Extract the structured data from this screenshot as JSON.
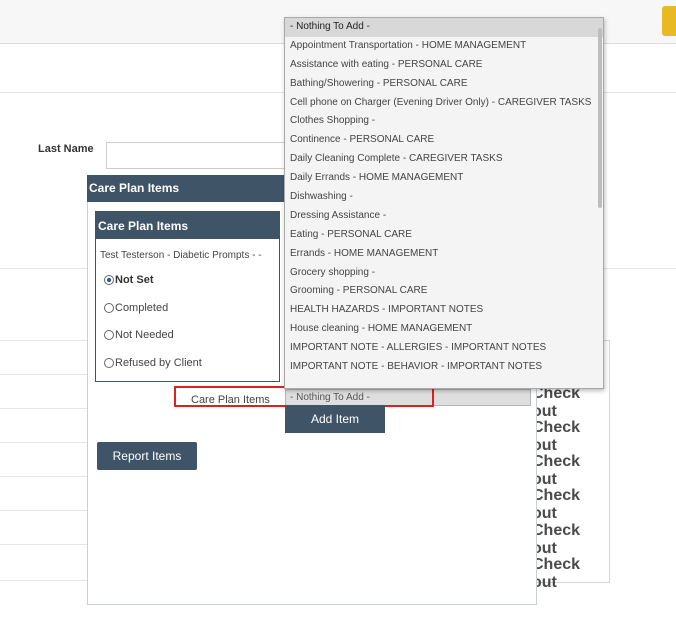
{
  "filters": {
    "last_name_label": "Last Name",
    "last_name_value": ""
  },
  "panel": {
    "outer_title": "Care Plan Items",
    "inner_title": "Care Plan Items",
    "prompt": "Test Testerson - Diabetic Prompts - -",
    "statuses": [
      "Not Set",
      "Completed",
      "Not Needed",
      "Refused by Client"
    ],
    "selected_status": "Not Set",
    "care_plan_items_label": "Care Plan Items",
    "select_value": "- Nothing To Add -",
    "add_item_label": "Add Item",
    "report_items_label": "Report Items"
  },
  "checkout_label": "Check out",
  "checkout_rows": [
    "Check out",
    "Check out",
    "Check out",
    "Check out",
    "Check out",
    "Check out"
  ],
  "dropdown": {
    "options": [
      "- Nothing To Add -",
      "Appointment Transportation - HOME MANAGEMENT",
      "Assistance with eating - PERSONAL CARE",
      "Bathing/Showering - PERSONAL CARE",
      "Cell phone on Charger (Evening Driver Only) - CAREGIVER TASKS",
      "Clothes Shopping -",
      "Continence - PERSONAL CARE",
      "Daily Cleaning Complete - CAREGIVER TASKS",
      "Daily Errands - HOME MANAGEMENT",
      "Dishwashing -",
      "Dressing Assistance -",
      "Eating - PERSONAL CARE",
      "Errands - HOME MANAGEMENT",
      "Grocery shopping -",
      "Grooming - PERSONAL CARE",
      "HEALTH HAZARDS - IMPORTANT NOTES",
      "House cleaning - HOME MANAGEMENT",
      "IMPORTANT NOTE - ALLERGIES - IMPORTANT NOTES",
      "IMPORTANT NOTE - BEHAVIOR - IMPORTANT NOTES"
    ],
    "highlighted": "- Nothing To Add -"
  },
  "colors": {
    "header": "#3f5467",
    "highlight_box": "#e02020",
    "accent_corner": "#e8b923"
  }
}
